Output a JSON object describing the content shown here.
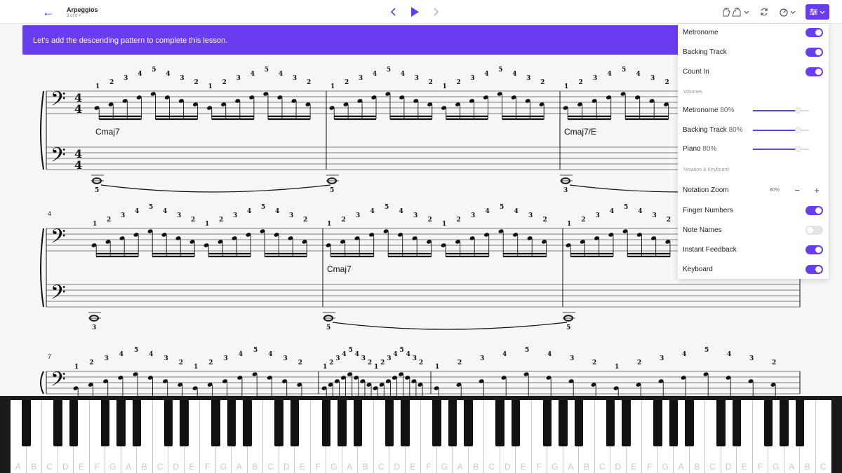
{
  "header": {
    "title": "Arpeggios",
    "subtitle": "3 of 9 ˅",
    "back_icon": "arrow-left-icon",
    "accent": "#6a3cf0"
  },
  "banner": {
    "text": "Let's add the descending pattern to complete this lesson."
  },
  "score": {
    "measure_numbers": [
      "4",
      "7"
    ],
    "chords": [
      "Cmaj7",
      "Cmaj7/E",
      "Cmaj7"
    ],
    "time_signature_top": "4",
    "time_signature_bottom": "4",
    "left_hand_fingers": [
      "5",
      "5",
      "3",
      "3",
      "5",
      "5"
    ],
    "right_hand_fingers_group": [
      "1",
      "2",
      "3",
      "4",
      "5",
      "4",
      "3",
      "2",
      "1",
      "2",
      "3",
      "4",
      "5",
      "4",
      "3",
      "2"
    ]
  },
  "settings": {
    "metronome": {
      "label": "Metronome",
      "on": true
    },
    "backing_track": {
      "label": "Backing Track",
      "on": true
    },
    "count_in": {
      "label": "Count In",
      "on": true
    },
    "volumes_heading": "Volumes",
    "volumes": [
      {
        "label": "Metronome",
        "pct": "80%",
        "value": 0.8
      },
      {
        "label": "Backing Track",
        "pct": "80%",
        "value": 0.8
      },
      {
        "label": "Piano",
        "pct": "80%",
        "value": 0.8
      }
    ],
    "notation_heading": "Notation & Keyboard",
    "notation_zoom": {
      "label": "Notation Zoom",
      "value": "80%",
      "minus": "−",
      "plus": "+"
    },
    "finger_numbers": {
      "label": "Finger Numbers",
      "on": true
    },
    "note_names": {
      "label": "Note Names",
      "on": false
    },
    "instant_feedback": {
      "label": "Instant Feedback",
      "on": true
    },
    "keyboard": {
      "label": "Keyboard",
      "on": true
    }
  },
  "keyboard": {
    "white_keys": [
      "A",
      "B",
      "C",
      "D",
      "E",
      "F",
      "G",
      "A",
      "B",
      "C",
      "D",
      "E",
      "F",
      "G",
      "A",
      "B",
      "C",
      "D",
      "E",
      "F",
      "G",
      "A",
      "B",
      "C",
      "D",
      "E",
      "F",
      "G",
      "A",
      "B",
      "C",
      "D",
      "E",
      "F",
      "G",
      "A",
      "B",
      "C",
      "D",
      "E",
      "F",
      "G",
      "A",
      "B",
      "C",
      "D",
      "E",
      "F",
      "G",
      "A",
      "B",
      "C"
    ],
    "active_key_color": "#3f8fd8"
  }
}
